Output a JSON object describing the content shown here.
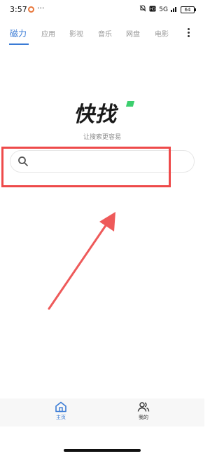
{
  "status_bar": {
    "time": "3:57",
    "more": "···",
    "signal_text": "5G",
    "battery": "64"
  },
  "tabs": [
    {
      "label": "磁力",
      "active": true
    },
    {
      "label": "应用",
      "active": false
    },
    {
      "label": "影视",
      "active": false
    },
    {
      "label": "音乐",
      "active": false
    },
    {
      "label": "网盘",
      "active": false
    },
    {
      "label": "电影",
      "active": false
    }
  ],
  "logo": {
    "text": "快找"
  },
  "slogan": "让搜索更容易",
  "search": {
    "placeholder": ""
  },
  "colors": {
    "accent": "#3a7bd5",
    "logo_green": "#3ccf6e",
    "annotation_red": "#ee4a4a"
  },
  "bottom_nav": {
    "items": [
      {
        "label": "主页",
        "icon": "home-icon",
        "active": true
      },
      {
        "label": "我的",
        "icon": "users-icon",
        "active": false
      }
    ]
  }
}
